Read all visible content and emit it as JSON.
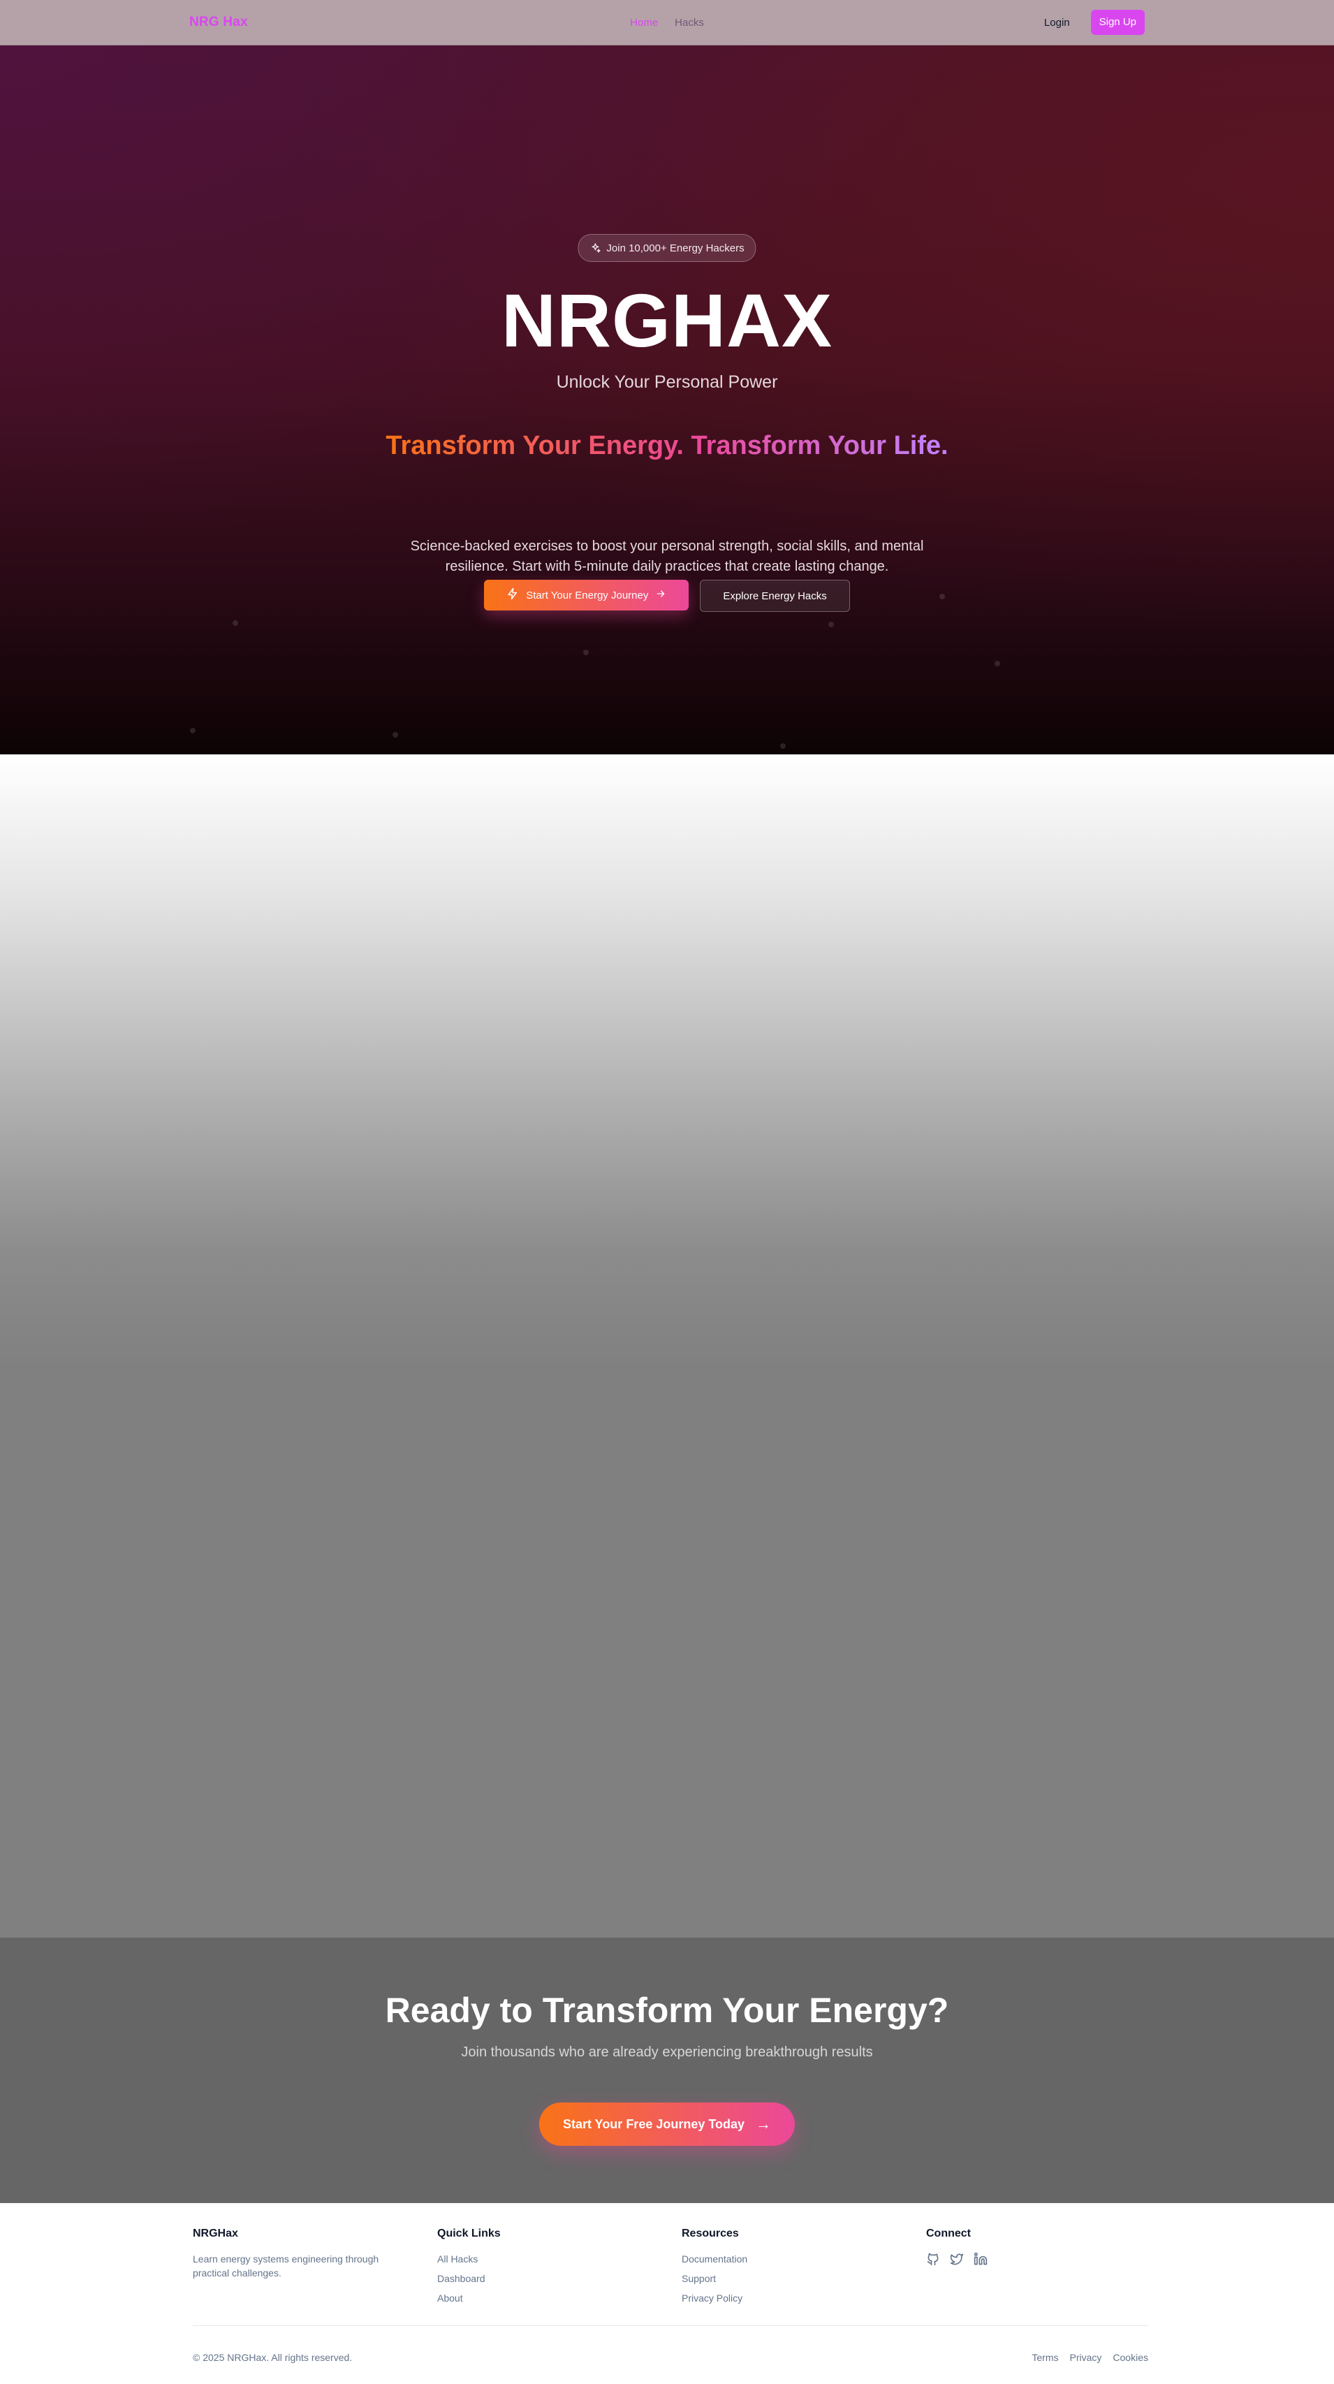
{
  "nav": {
    "logo": "NRG Hax",
    "links": [
      {
        "label": "Home",
        "active": true
      },
      {
        "label": "Hacks",
        "active": false
      }
    ],
    "login": "Login",
    "signup": "Sign Up"
  },
  "hero": {
    "badge": "Join 10,000+ Energy Hackers",
    "badge_icon": "sparkles-icon",
    "title": "NRGHAX",
    "subtitle": "Unlock Your Personal Power",
    "tagline": "Transform Your Energy. Transform Your Life.",
    "description": "Science-backed exercises to boost your personal strength, social skills, and mental resilience. Start with 5-minute daily practices that create lasting change.",
    "primary_cta": "Start Your Energy Journey",
    "primary_cta_icon": "zap-icon",
    "secondary_cta": "Explore Energy Hacks"
  },
  "cta": {
    "title": "Ready to Transform Your Energy?",
    "subtitle": "Join thousands who are already experiencing breakthrough results",
    "button": "Start Your Free Journey Today",
    "button_arrow": "→"
  },
  "footer": {
    "brand": "NRGHax",
    "brand_desc": "Learn energy systems engineering through practical challenges.",
    "quick_links_title": "Quick Links",
    "quick_links": [
      "All Hacks",
      "Dashboard",
      "About"
    ],
    "resources_title": "Resources",
    "resources": [
      "Documentation",
      "Support",
      "Privacy Policy"
    ],
    "connect_title": "Connect",
    "social_icons": [
      "github-icon",
      "twitter-icon",
      "linkedin-icon"
    ],
    "copyright": "© 2025 NRGHax. All rights reserved.",
    "legal": [
      "Terms",
      "Privacy",
      "Cookies"
    ]
  },
  "colors": {
    "brand": "#d946ef",
    "gradient_start": "#f97316",
    "gradient_end": "#ec4899"
  }
}
